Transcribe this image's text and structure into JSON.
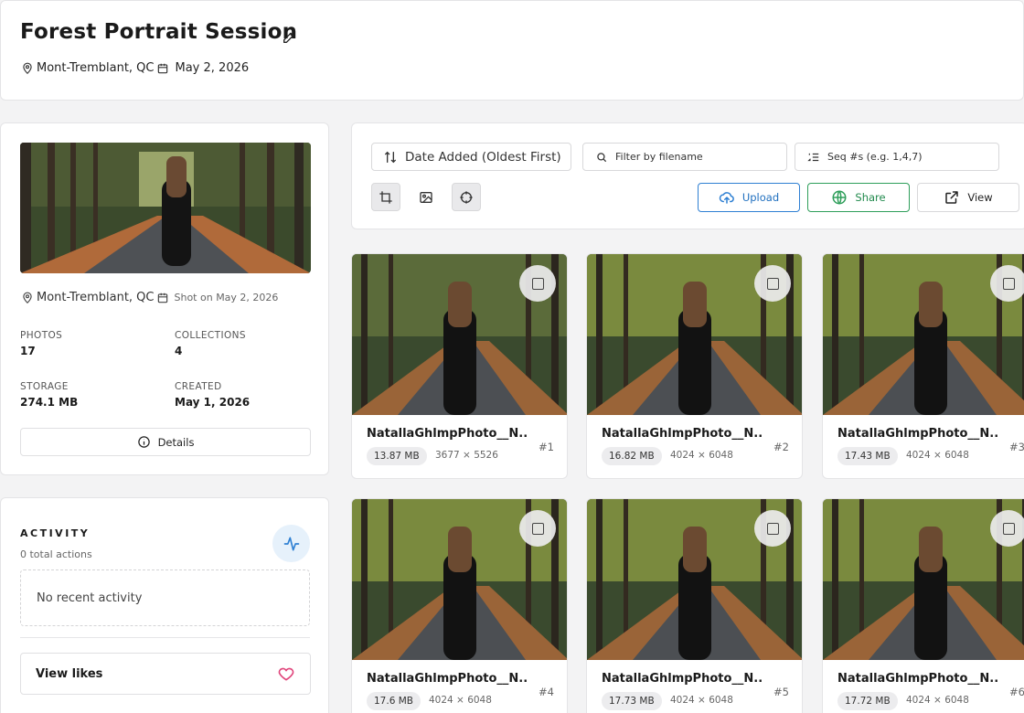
{
  "header": {
    "title": "Forest Portrait Session",
    "location": "Mont-Tremblant, QC",
    "date": "May 2, 2026"
  },
  "cover": {
    "location": "Mont-Tremblant, QC",
    "shot_on": "Shot on May 2, 2026"
  },
  "stats": [
    {
      "label": "PHOTOS",
      "value": "17"
    },
    {
      "label": "COLLECTIONS",
      "value": "4"
    },
    {
      "label": "STORAGE",
      "value": "274.1 MB"
    },
    {
      "label": "CREATED",
      "value": "May 1, 2026"
    }
  ],
  "details_label": "Details",
  "activity": {
    "title": "ACTIVITY",
    "subtitle": "0 total actions",
    "empty": "No recent activity",
    "view_likes": "View likes"
  },
  "toolbar": {
    "sort_label": "Date Added (Oldest First)",
    "filter_placeholder": "Filter by filename",
    "seq_placeholder": "Seq #s (e.g. 1,4,7)",
    "upload": "Upload",
    "share": "Share",
    "view": "View"
  },
  "photos": [
    {
      "name": "NatallaGhlmpPhoto__N...",
      "size": "13.87 MB",
      "dims": "3677 × 5526",
      "seq": "#1"
    },
    {
      "name": "NatallaGhlmpPhoto__N...",
      "size": "16.82 MB",
      "dims": "4024 × 6048",
      "seq": "#2"
    },
    {
      "name": "NatallaGhlmpPhoto__N...",
      "size": "17.43 MB",
      "dims": "4024 × 6048",
      "seq": "#3"
    },
    {
      "name": "NatallaGhlmpPhoto__N...",
      "size": "17.6 MB",
      "dims": "4024 × 6048",
      "seq": "#4"
    },
    {
      "name": "NatallaGhlmpPhoto__N...",
      "size": "17.73 MB",
      "dims": "4024 × 6048",
      "seq": "#5"
    },
    {
      "name": "NatallaGhlmpPhoto__N...",
      "size": "17.72 MB",
      "dims": "4024 × 6048",
      "seq": "#6"
    }
  ],
  "colors": {
    "accent_blue": "#2f80d3",
    "accent_green": "#2e9e5a",
    "like_pink": "#e0457b",
    "activity_icon_bg": "#e6f1fb"
  }
}
